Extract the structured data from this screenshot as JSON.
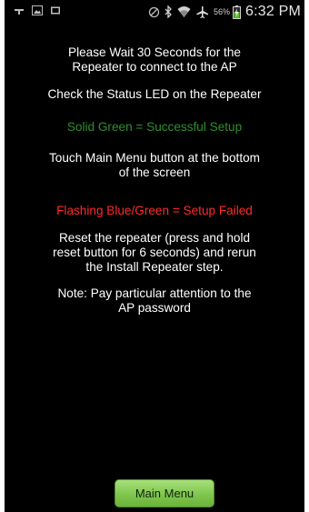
{
  "status_bar": {
    "battery_percent": "56%",
    "time": "6:32 PM",
    "left_icons": [
      "android-debug-icon",
      "image-notification-icon",
      "message-notification-icon"
    ],
    "right_icons": [
      "no-sim-icon",
      "bluetooth-icon",
      "wifi-icon",
      "airplane-mode-icon",
      "battery-charging-icon"
    ]
  },
  "content": {
    "wait_message": "Please Wait 30 Seconds for the Repeater to connect to the AP",
    "check_led": "Check the Status LED on the Repeater",
    "success_line": "Solid Green = Successful Setup",
    "touch_main_menu": "Touch Main Menu button at the bottom of the screen",
    "failed_line": "Flashing Blue/Green = Setup Failed",
    "reset_instructions": "Reset the repeater (press and hold reset button for 6 seconds) and rerun the Install Repeater step.",
    "note": "Note: Pay particular attention to the AP password"
  },
  "footer": {
    "main_menu_label": "Main Menu"
  },
  "colors": {
    "background": "#000000",
    "text": "#ffffff",
    "success": "#2f8f2f",
    "failure": "#ff2a2a",
    "button": "#7cc44a"
  }
}
